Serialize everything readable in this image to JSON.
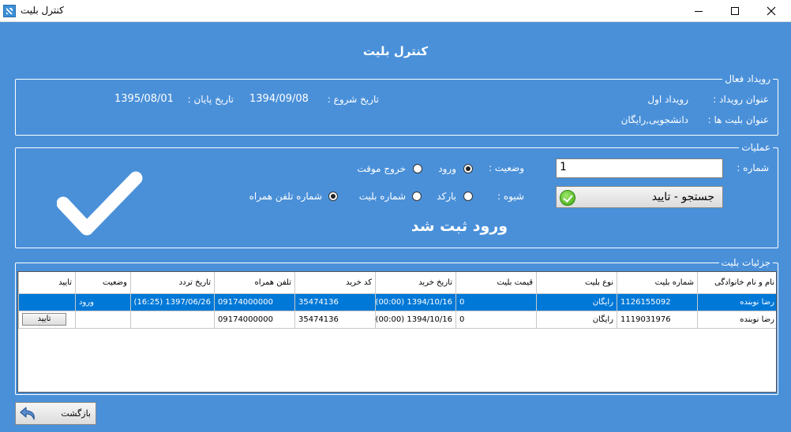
{
  "window": {
    "title": "کنترل بلیت"
  },
  "page": {
    "title": "کنترل بلیت"
  },
  "event": {
    "legend": "رویداد فعال",
    "event_title_label": "عنوان رویداد :",
    "event_title_value": "رویداد اول",
    "ticket_titles_label": "عنوان بلیت ها :",
    "ticket_titles_value": "دانشجویی,رایگان",
    "start_label": "تاریخ شروع :",
    "start_value": "1394/09/08",
    "end_label": "تاریخ پایان :",
    "end_value": "1395/08/01"
  },
  "operations": {
    "legend": "عملیات",
    "number_label": "شماره :",
    "number_value": "1",
    "status_label": "وضعیت :",
    "status_options": [
      {
        "label": "ورود",
        "checked": true
      },
      {
        "label": "خروج موقت",
        "checked": false
      }
    ],
    "method_label": "شیوه :",
    "method_options": [
      {
        "label": "بارکد",
        "checked": false
      },
      {
        "label": "شماره بلیت",
        "checked": false
      },
      {
        "label": "شماره تلفن همراه",
        "checked": true
      }
    ],
    "search_button": "جستجو - تایید",
    "result_text": "ورود ثبت شد",
    "icons": {
      "big": "check-icon",
      "button": "ok-icon"
    }
  },
  "details": {
    "legend": "جزئیات بلیت",
    "columns": [
      "نام و نام خانوادگی",
      "شماره بلیت",
      "نوع بلیت",
      "قیمت بلیت",
      "تاریخ خرید",
      "کد خرید",
      "تلفن همراه",
      "تاریخ تردد",
      "وضعیت",
      "تایید"
    ],
    "rows": [
      {
        "name": "رضا نوبنده",
        "ticket_no": "1126155092",
        "type": "رایگان",
        "price": "0",
        "purchase_date": "1394/10/16 (00:00)",
        "purchase_code": "35474136",
        "mobile": "09174000000",
        "traffic_date": "1397/06/26 (16:25)",
        "status": "ورود",
        "confirm": ""
      },
      {
        "name": "رضا نوبنده",
        "ticket_no": "1119031976",
        "type": "رایگان",
        "price": "0",
        "purchase_date": "1394/10/16 (00:00)",
        "purchase_code": "35474136",
        "mobile": "09174000000",
        "traffic_date": "",
        "status": "",
        "confirm": "تایید"
      }
    ]
  },
  "footer": {
    "back_button": "بازگشت",
    "back_icon": "back-arrow-icon"
  },
  "colors": {
    "background": "#4a90d9",
    "selection": "#0078d7"
  }
}
